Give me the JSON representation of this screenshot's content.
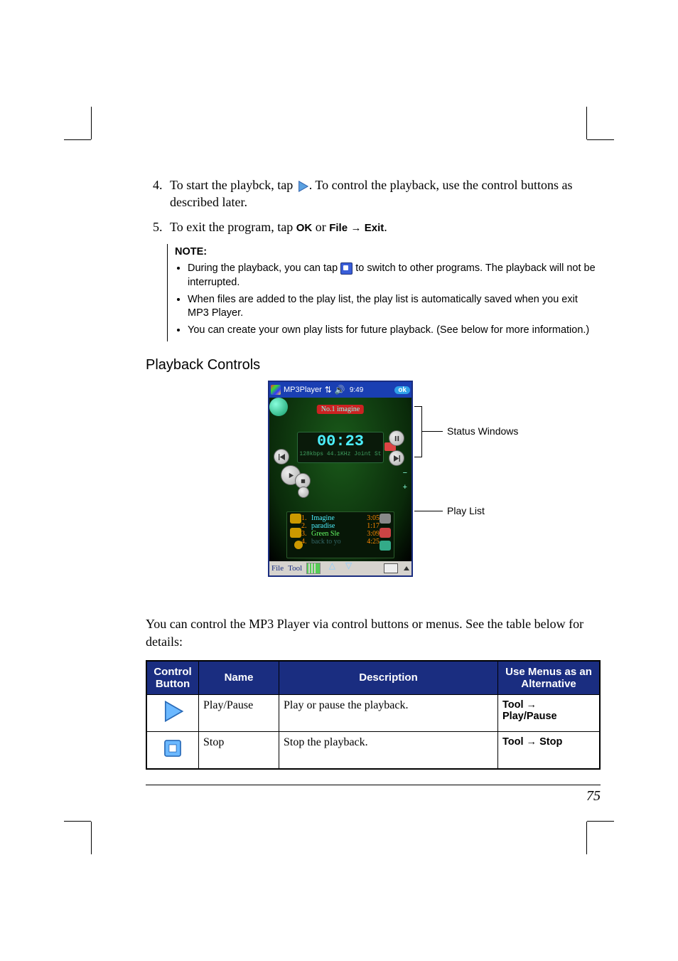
{
  "steps": {
    "start_num": 4,
    "item4_pre": "To start the playbck, tap ",
    "item4_post": ". To control the playback, use the control buttons as described later.",
    "item5_pre": "To exit the program, tap ",
    "item5_ok": "OK",
    "item5_mid": " or ",
    "item5_file": "File",
    "item5_arrow": " → ",
    "item5_exit": "Exit",
    "item5_end": "."
  },
  "note": {
    "heading": "NOTE:",
    "b1_pre": "During the playback, you can tap ",
    "b1_post": " to switch to other programs. The playback will not be interrupted.",
    "b2": "When files are added to the play list, the play list is automatically saved when you exit MP3 Player.",
    "b3": "You can create your own play lists for future playback. (See below for more information.)"
  },
  "section_heading": "Playback Controls",
  "screenshot": {
    "title": "MP3Player",
    "clock": "9:49",
    "ok": "ok",
    "track_label": "No.1 imagine",
    "time": "00:23",
    "meta": "128kbps 44.1KHz Joint St",
    "playlist": [
      {
        "n": "1.",
        "name": "Imagine",
        "dur": "3:05"
      },
      {
        "n": "2.",
        "name": "paradise",
        "dur": "1:17"
      },
      {
        "n": "3.",
        "name": "Green Sle",
        "dur": "3:09"
      },
      {
        "n": "4.",
        "name": "back to yo",
        "dur": "4:25"
      }
    ],
    "menu_file": "File",
    "menu_tool": "Tool"
  },
  "callouts": {
    "status": "Status Windows",
    "playlist": "Play List"
  },
  "body_para": "You can control the MP3 Player via control buttons or menus. See the table below for details:",
  "table": {
    "headers": {
      "c1": "Control Button",
      "c2": "Name",
      "c3": "Description",
      "c4": "Use Menus as an Alternative"
    },
    "rows": [
      {
        "name": "Play/Pause",
        "desc": "Play or pause the playback.",
        "menu_pre": "Tool",
        "menu_arrow": " → ",
        "menu_post": "Play/Pause"
      },
      {
        "name": "Stop",
        "desc": "Stop the playback.",
        "menu_pre": "Tool",
        "menu_arrow": " → ",
        "menu_post": "Stop"
      }
    ]
  },
  "page_number": "75"
}
